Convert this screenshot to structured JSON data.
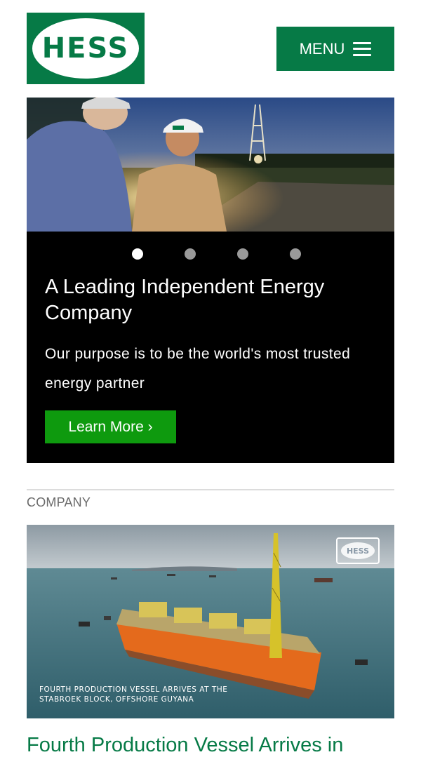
{
  "header": {
    "logo_text": "HESS",
    "menu_label": "MENU",
    "brand_color": "#067a46"
  },
  "hero": {
    "slide_count": 4,
    "active_slide": 1,
    "title": "A Leading Independent Energy Company",
    "description": "Our purpose is to be the world's most trusted energy partner",
    "cta_label": "Learn More ›",
    "cta_color": "#0e9a0e"
  },
  "news": {
    "section_label": "COMPANY",
    "image_caption_line1": "FOURTH PRODUCTION VESSEL ARRIVES AT THE",
    "image_caption_line2": "STABROEK BLOCK, OFFSHORE GUYANA",
    "watermark_text": "HESS",
    "title": "Fourth Production Vessel Arrives in"
  },
  "icons": [
    "hamburger-icon",
    "slide-dot"
  ]
}
